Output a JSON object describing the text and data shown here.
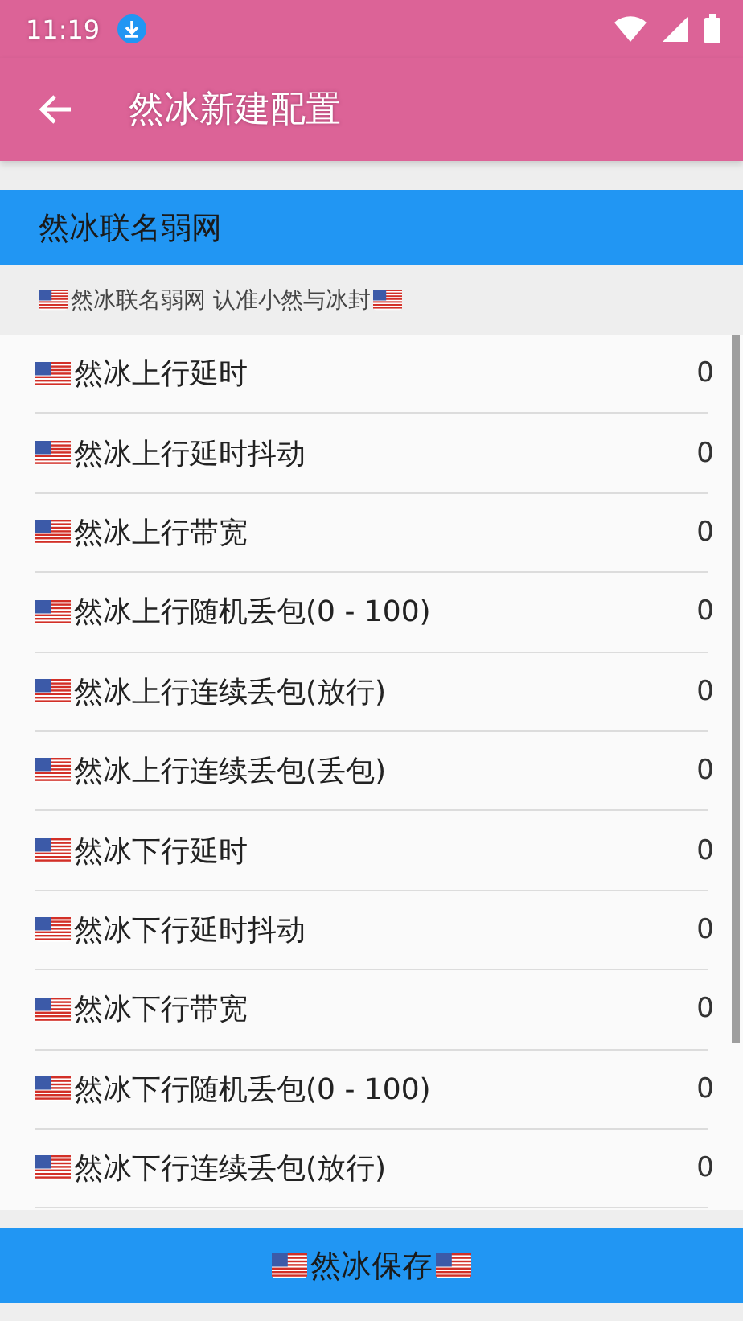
{
  "status_bar": {
    "time": "11:19"
  },
  "app_bar": {
    "title": "然冰新建配置"
  },
  "banner": {
    "title": "然冰联名弱网"
  },
  "subtitle": {
    "text": "然冰联名弱网 认准小然与冰封"
  },
  "settings": [
    {
      "label": "然冰上行延时",
      "value": "0"
    },
    {
      "label": "然冰上行延时抖动",
      "value": "0"
    },
    {
      "label": "然冰上行带宽",
      "value": "0"
    },
    {
      "label": "然冰上行随机丢包(0 - 100)",
      "value": "0"
    },
    {
      "label": "然冰上行连续丢包(放行)",
      "value": "0"
    },
    {
      "label": "然冰上行连续丢包(丢包)",
      "value": "0"
    },
    {
      "label": "然冰下行延时",
      "value": "0"
    },
    {
      "label": "然冰下行延时抖动",
      "value": "0"
    },
    {
      "label": "然冰下行带宽",
      "value": "0"
    },
    {
      "label": "然冰下行随机丢包(0 - 100)",
      "value": "0"
    },
    {
      "label": "然冰下行连续丢包(放行)",
      "value": "0"
    }
  ],
  "save_button": {
    "label": "然冰保存"
  }
}
